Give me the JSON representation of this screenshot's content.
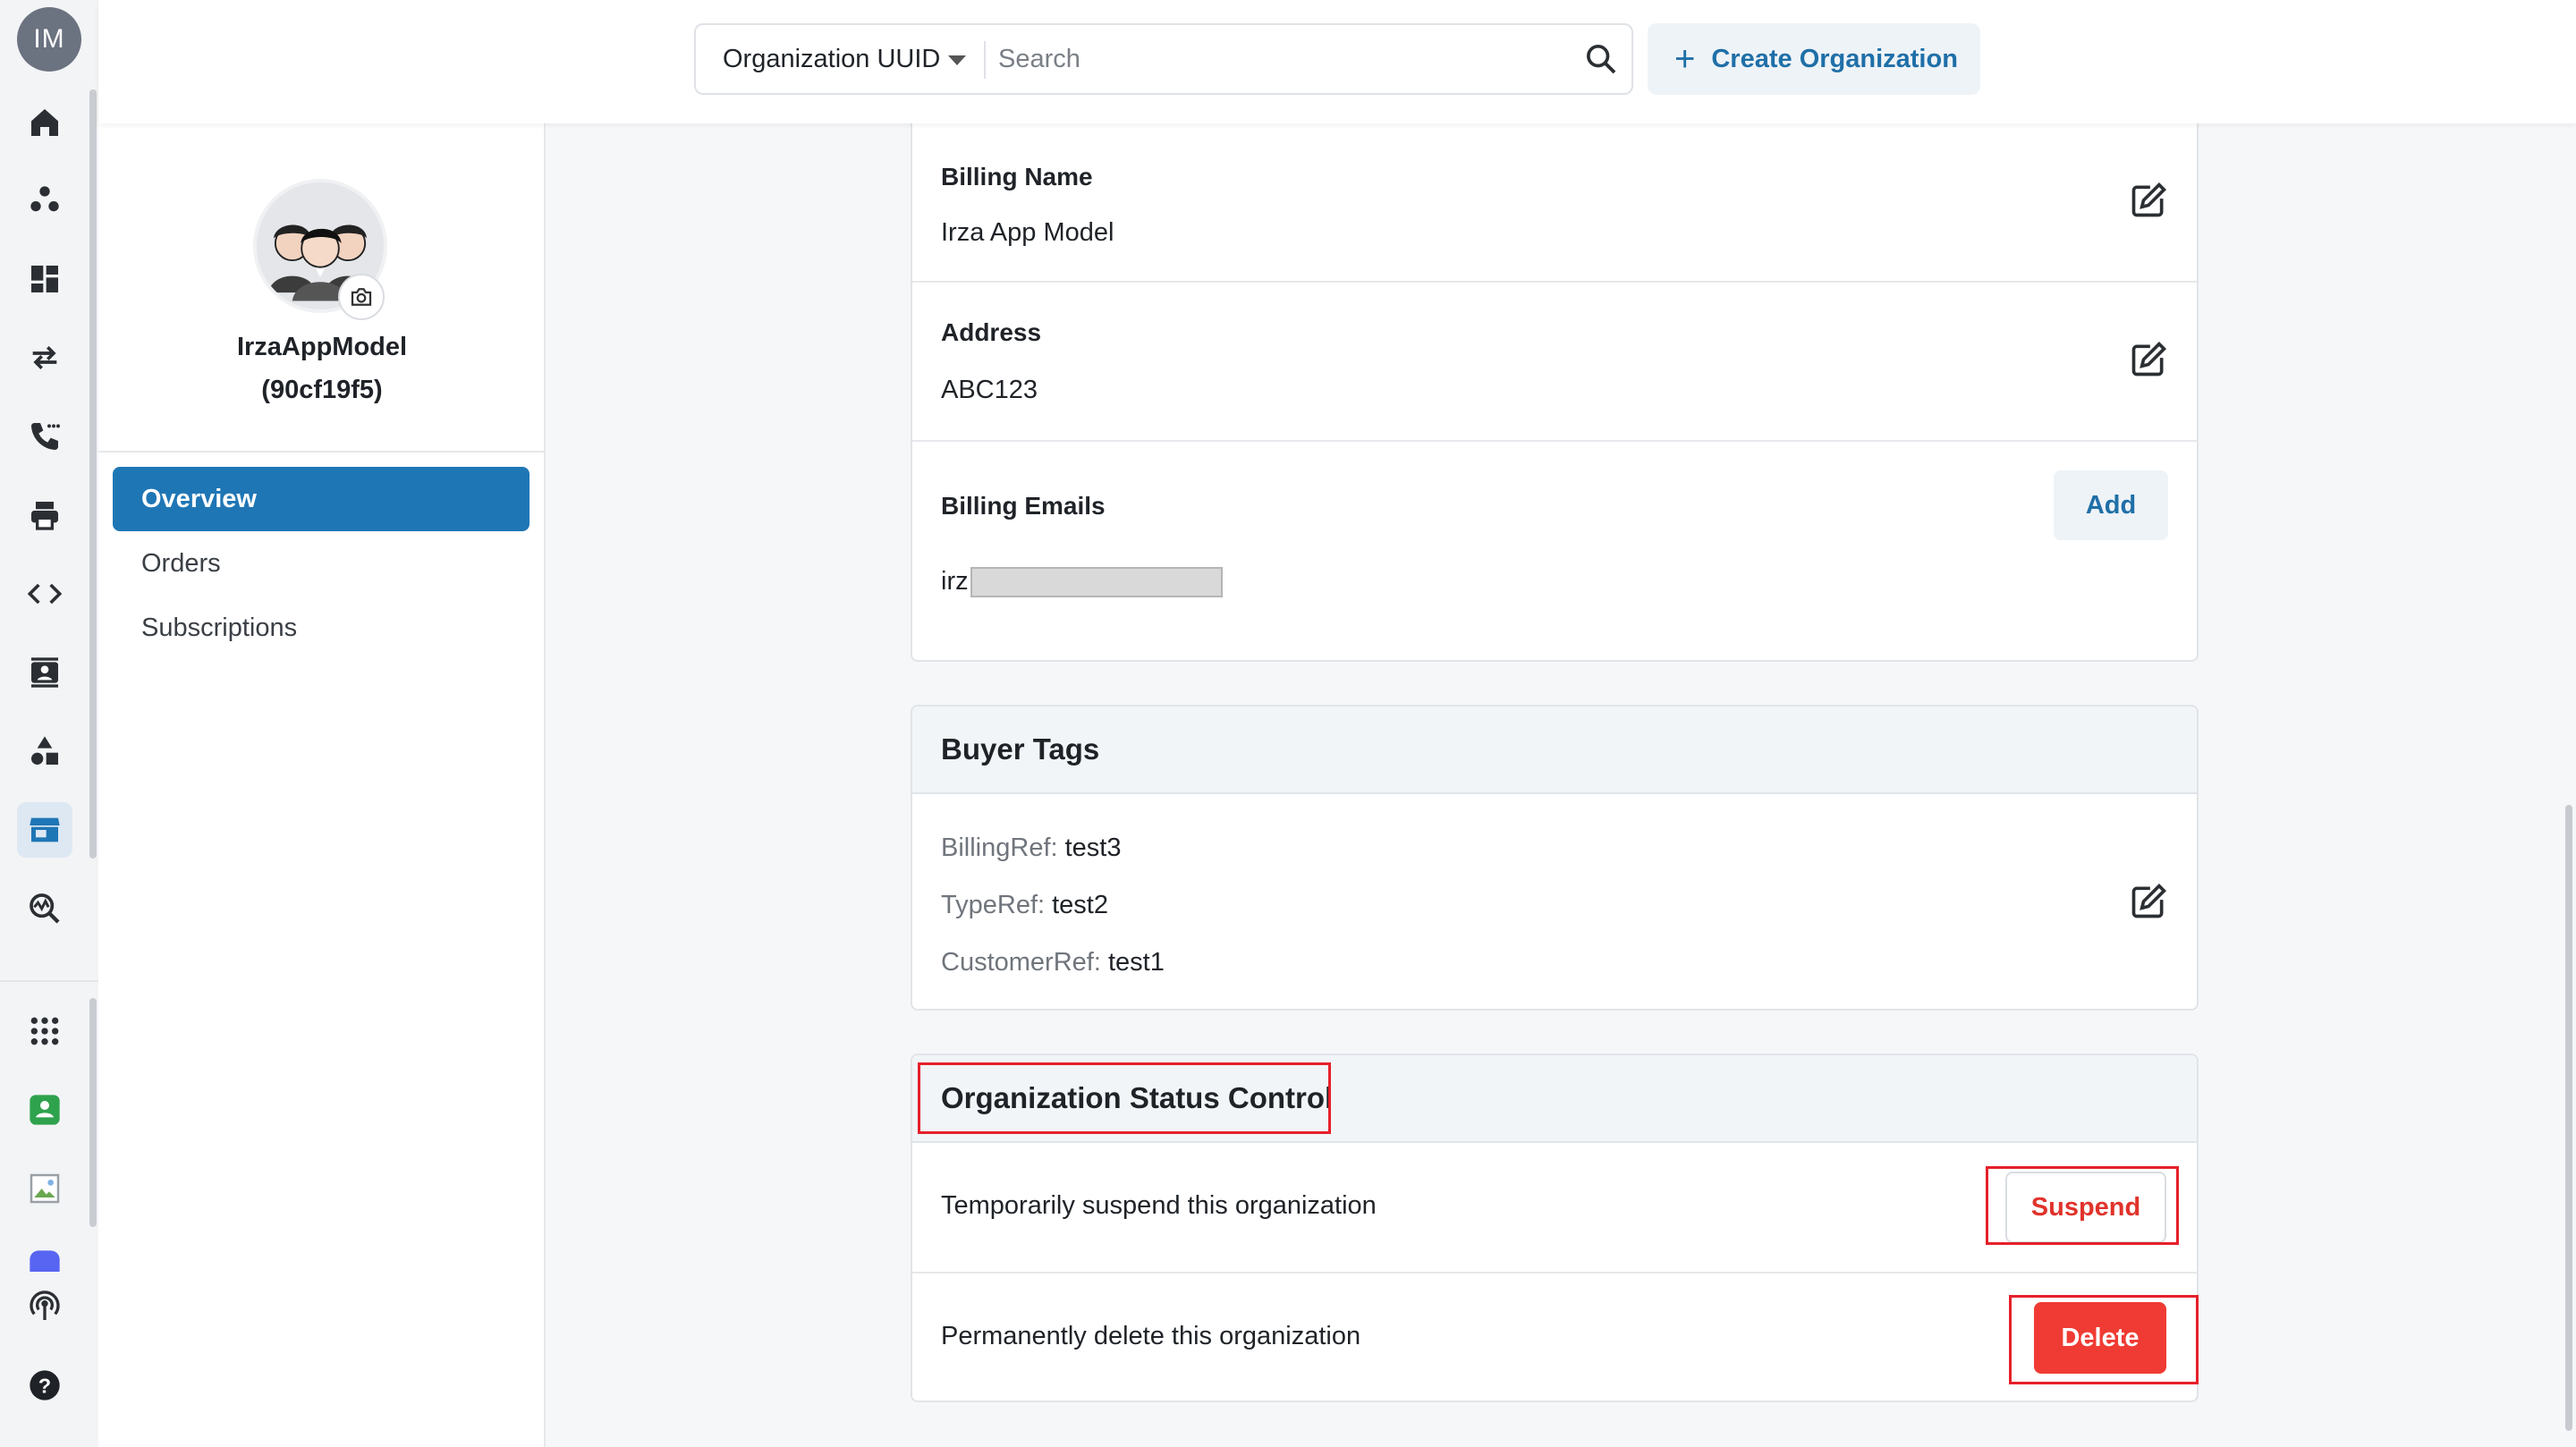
{
  "user": {
    "initials": "IM"
  },
  "search": {
    "filter_label": "Organization UUID",
    "placeholder": "Search"
  },
  "toolbar": {
    "create_label": "Create Organization"
  },
  "organization": {
    "name": "IrzaAppModel",
    "short_id": "(90cf19f5)"
  },
  "nav": {
    "items": [
      {
        "label": "Overview"
      },
      {
        "label": "Orders"
      },
      {
        "label": "Subscriptions"
      }
    ]
  },
  "billing": {
    "name_label": "Billing Name",
    "name_value": "Irza App Model",
    "address_label": "Address",
    "address_value": "ABC123",
    "emails_label": "Billing Emails",
    "add_label": "Add",
    "email_prefix": "irz"
  },
  "buyer_tags": {
    "title": "Buyer Tags",
    "tags": [
      {
        "key": "BillingRef:",
        "value": "test3"
      },
      {
        "key": "TypeRef:",
        "value": "test2"
      },
      {
        "key": "CustomerRef:",
        "value": "test1"
      }
    ]
  },
  "status_control": {
    "title": "Organization Status Control",
    "suspend_text": "Temporarily suspend this organization",
    "suspend_label": "Suspend",
    "delete_text": "Permanently delete this organization",
    "delete_label": "Delete"
  },
  "colors": {
    "accent": "#1f76b5",
    "danger": "#ef3b33",
    "highlight": "#e6202a"
  }
}
